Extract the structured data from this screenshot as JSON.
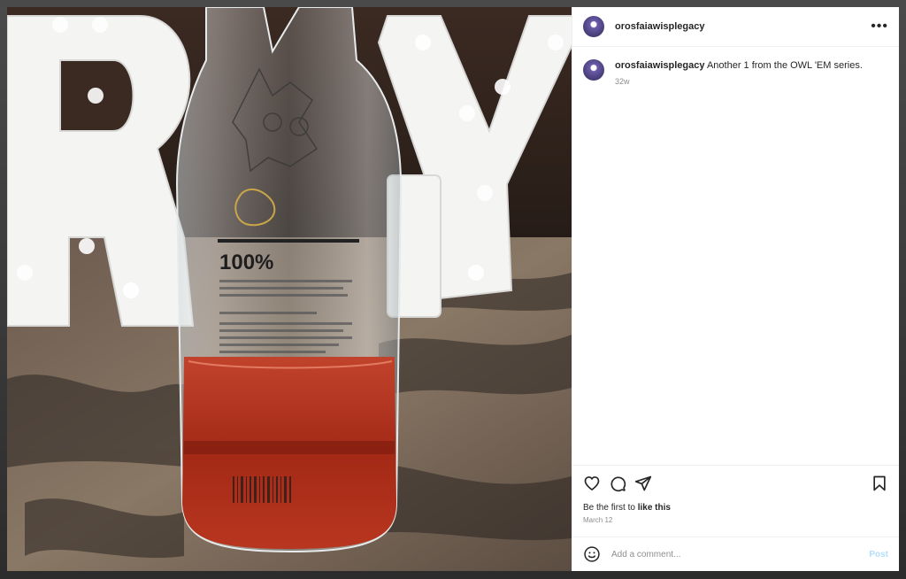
{
  "post": {
    "username": "orosfaiawisplegacy",
    "more_icon": "more-horizontal-icon",
    "photo_label": "100%"
  },
  "caption": {
    "username": "orosfaiawisplegacy",
    "text": "Another 1 from the OWL 'EM series.",
    "time_ago": "32w"
  },
  "actions": {
    "icons": [
      "heart-icon",
      "comment-icon",
      "share-icon",
      "bookmark-icon"
    ]
  },
  "likes": {
    "prefix": "Be the first to",
    "link": "like this"
  },
  "date": "March 12",
  "comment_box": {
    "placeholder": "Add a comment...",
    "post_label": "Post",
    "emoji_icon": "emoji-icon"
  },
  "colors": {
    "accent_disabled": "#b2dffc",
    "text_primary": "#262626",
    "text_secondary": "#8e8e8e",
    "liquid": "#b5311c"
  }
}
